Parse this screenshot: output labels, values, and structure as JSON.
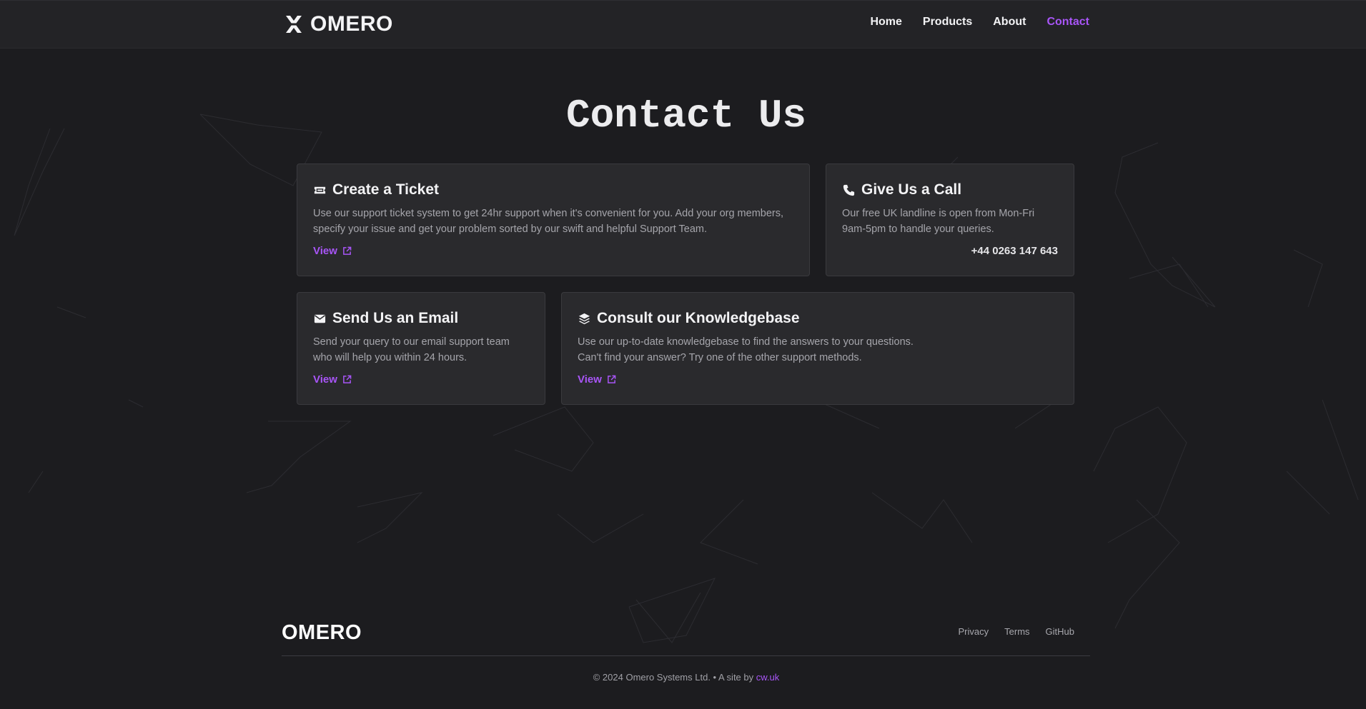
{
  "nav": {
    "brand": "OMERO",
    "links": [
      {
        "label": "Home"
      },
      {
        "label": "Products"
      },
      {
        "label": "About"
      },
      {
        "label": "Contact",
        "active": true
      }
    ]
  },
  "page_title": "Contact Us",
  "cards": {
    "ticket": {
      "icon": "ticket-icon",
      "title": "Create a Ticket",
      "text": "Use our support ticket system to get 24hr support when it's convenient for you. Add your org members, specify your issue and get your problem sorted by our swift and helpful Support Team.",
      "link": "View"
    },
    "call": {
      "icon": "phone-icon",
      "title": "Give Us a Call",
      "text": "Our free UK landline is open from Mon-Fri 9am-5pm to handle your queries.",
      "phone": "+44 0263 147 643"
    },
    "email": {
      "icon": "envelope-icon",
      "title": "Send Us an Email",
      "text": "Send your query to our email support team who will help you within 24 hours.",
      "link": "View"
    },
    "knowledgebase": {
      "icon": "layers-icon",
      "title": "Consult our Knowledgebase",
      "text_line1": "Use our up-to-date knowledgebase to find the answers to your questions.",
      "text_line2": "Can't find your answer? Try one of the other support methods.",
      "link": "View"
    }
  },
  "footer": {
    "logo": "OMERO",
    "links": [
      "Privacy",
      "Terms",
      "GitHub"
    ],
    "copyright": "© 2024 Omero Systems Ltd. • A site by ",
    "site_link": "cw.uk"
  },
  "colors": {
    "background": "#1c1c1f",
    "navbar": "#232326",
    "card": "#2a2a2d",
    "accent": "#a855f7"
  }
}
